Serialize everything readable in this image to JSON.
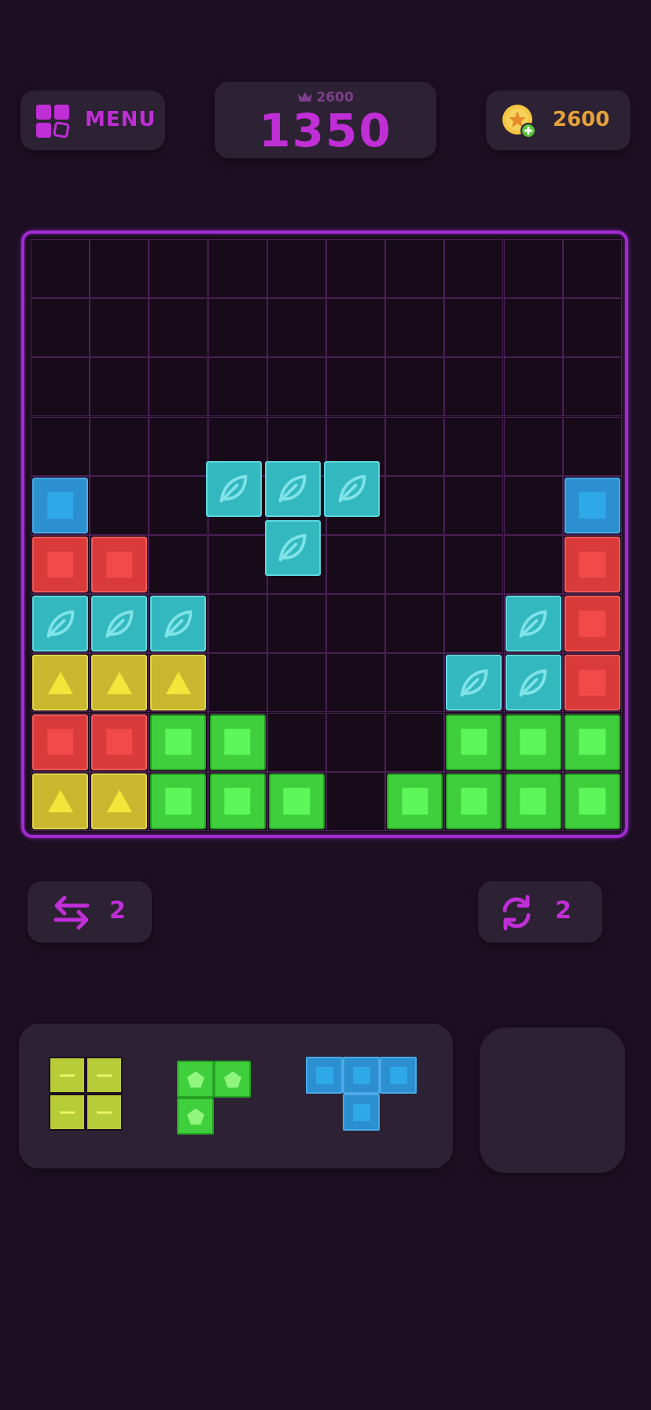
{
  "header": {
    "menu_label": "MENU",
    "best_score": "2600",
    "score": "1350",
    "coins": "2600"
  },
  "powerups": {
    "swap_count": "2",
    "rotate_count": "2"
  },
  "colors": {
    "accent": "#c02ed6",
    "coin": "#e5a13a",
    "teal": "#33b8bf",
    "blue": "#2c8fcf",
    "red": "#d93a3a",
    "yellow": "#c9b82f",
    "green": "#3fcf3c",
    "lime": "#b6cd37"
  },
  "board": {
    "rows": 10,
    "cols": 10,
    "legend": {
      ".": "empty",
      "T": "teal-leaf",
      "B": "blue-square",
      "R": "red-square",
      "Y": "yellow-triangle",
      "G": "green-square"
    },
    "grid": [
      "..........",
      "..........",
      "..........",
      "..........",
      "B........B",
      "RR.......R",
      "TTT.....TR",
      "YYY....TTR",
      "RRGG...GGG",
      "YYGGG.GGGG"
    ],
    "floating_piece": {
      "type": "teal-leaf",
      "cells": [
        [
          3.0,
          3.8
        ],
        [
          4.0,
          3.8
        ],
        [
          5.0,
          3.8
        ],
        [
          4.0,
          4.8
        ]
      ]
    }
  },
  "tray_pieces": [
    {
      "name": "lime-square-piece",
      "type": "lime-dash",
      "cells": [
        [
          0,
          0
        ],
        [
          1,
          0
        ],
        [
          0,
          1
        ],
        [
          1,
          1
        ]
      ]
    },
    {
      "name": "green-corner-piece",
      "type": "green-pentagon",
      "cells": [
        [
          0,
          0
        ],
        [
          1,
          0
        ],
        [
          0,
          1
        ]
      ]
    },
    {
      "name": "blue-t-piece",
      "type": "blue-square",
      "cells": [
        [
          0,
          0
        ],
        [
          1,
          0
        ],
        [
          2,
          0
        ],
        [
          1,
          1
        ]
      ]
    }
  ]
}
